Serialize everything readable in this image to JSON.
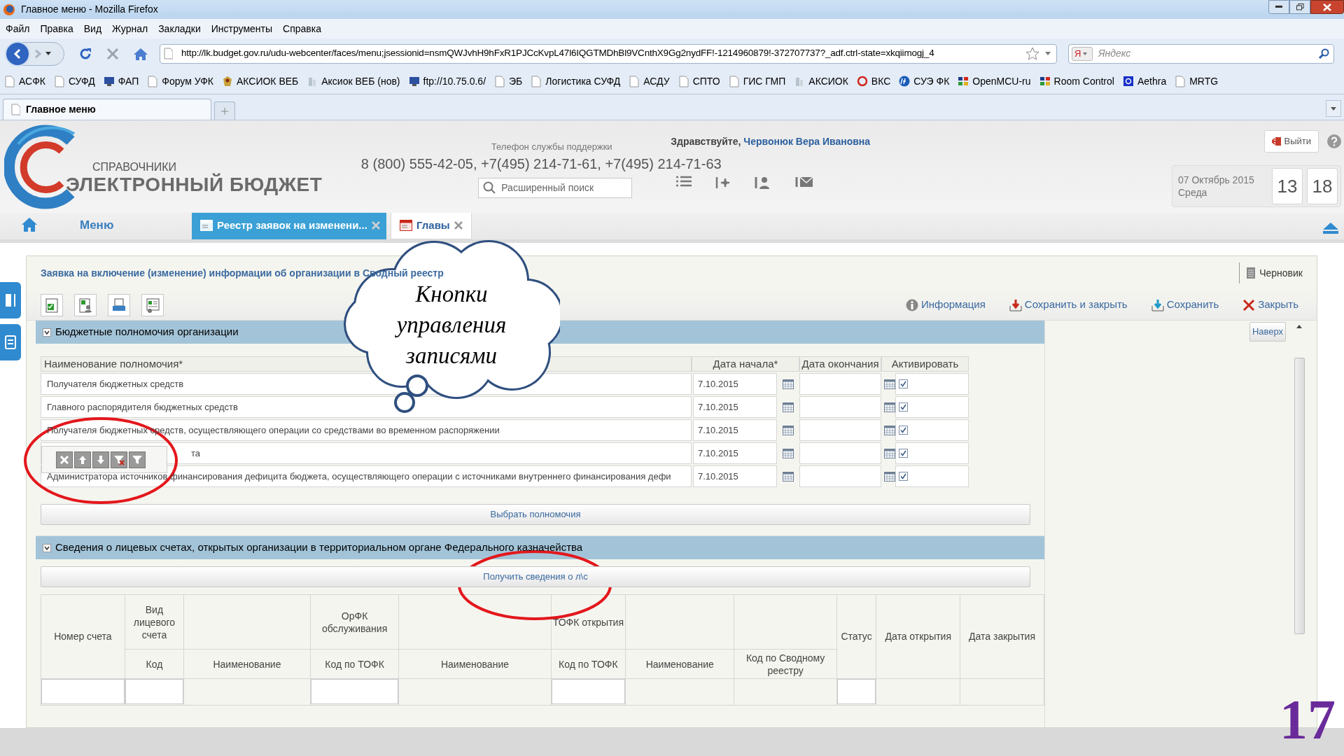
{
  "window": {
    "title": "Главное меню - Mozilla Firefox"
  },
  "menu_bar": [
    "Файл",
    "Правка",
    "Вид",
    "Журнал",
    "Закладки",
    "Инструменты",
    "Справка"
  ],
  "address_bar": {
    "url": "http://lk.budget.gov.ru/udu-webcenter/faces/menu;jsessionid=nsmQWJvhH9hFxR1PJCcKvpL47l6IQGTMDhBl9VCnthX9Gg2nydFF!-1214960879!-372707737?_adf.ctrl-state=xkqiimogj_4"
  },
  "search_box": {
    "engine": "Я",
    "placeholder": "Яндекс"
  },
  "bookmarks": [
    {
      "label": "АСФК",
      "kind": "page"
    },
    {
      "label": "СУФД",
      "kind": "page"
    },
    {
      "label": "ФАП",
      "kind": "monitor"
    },
    {
      "label": "Форум УФК",
      "kind": "page"
    },
    {
      "label": "АКСИОК ВЕБ",
      "kind": "emblem"
    },
    {
      "label": "Аксиок ВЕБ (нов)",
      "kind": "building"
    },
    {
      "label": "ftp://10.75.0.6/",
      "kind": "monitor"
    },
    {
      "label": "ЭБ",
      "kind": "page"
    },
    {
      "label": "Логистика СУФД",
      "kind": "page"
    },
    {
      "label": "АСДУ",
      "kind": "page"
    },
    {
      "label": "СПТО",
      "kind": "page"
    },
    {
      "label": "ГИС ГМП",
      "kind": "page"
    },
    {
      "label": "АКСИОК",
      "kind": "building"
    },
    {
      "label": "ВКС",
      "kind": "ring"
    },
    {
      "label": "СУЭ ФК",
      "kind": "hp"
    },
    {
      "label": "OpenMCU-ru",
      "kind": "grid"
    },
    {
      "label": "Room Control",
      "kind": "grid"
    },
    {
      "label": "Aethra",
      "kind": "blue"
    },
    {
      "label": "MRTG",
      "kind": "page"
    }
  ],
  "tabs": [
    {
      "label": "Главное меню",
      "selected": true
    }
  ],
  "header": {
    "logo_small": "СПРАВОЧНИКИ",
    "logo_large": "ЭЛЕКТРОННЫЙ БЮДЖЕТ",
    "support_label": "Телефон службы поддержки",
    "phones": "8 (800) 555-42-05, +7(495) 214-71-61, +7(495) 214-71-63",
    "search_placeholder": "Расширенный поиск",
    "greeting": "Здравствуйте,",
    "user": "Червонюк Вера Ивановна",
    "logout": "Выйти",
    "date": "07 Октябрь 2015",
    "weekday": "Среда",
    "hours": "13",
    "minutes": "18"
  },
  "app_tabs": [
    {
      "label": "Меню",
      "kind": "menu",
      "selected": false
    },
    {
      "label": "Реестр заявок на изменени...",
      "kind": "tab",
      "selected": true
    },
    {
      "label": "Главы",
      "kind": "tab",
      "selected": false
    }
  ],
  "form": {
    "title": "Заявка на включение (изменение) информации об организации в Сводный реестр",
    "status": "Черновик",
    "actions": [
      {
        "label": "Информация",
        "kind": "info"
      },
      {
        "label": "Сохранить и закрыть",
        "kind": "save_close"
      },
      {
        "label": "Сохранить",
        "kind": "save"
      },
      {
        "label": "Закрыть",
        "kind": "close"
      }
    ],
    "top_button": "Наверх"
  },
  "powers_section": {
    "title": "Бюджетные полномочия организации",
    "expanded": true,
    "columns": [
      "Наименование полномочия*",
      "Дата начала*",
      "Дата окончания",
      "Активировать"
    ],
    "rows": [
      {
        "name": "Получателя бюджетных средств",
        "start": "7.10.2015",
        "active": true
      },
      {
        "name": "Главного распорядителя бюджетных средств",
        "start": "7.10.2015",
        "active": true
      },
      {
        "name": "Получателя бюджетных средств, осуществляющего операции со средствами во временном распоряжении",
        "start": "7.10.2015",
        "active": true
      },
      {
        "name": "та",
        "start": "7.10.2015",
        "active": true
      },
      {
        "name": "Администратора источников финансирования дефицита бюджета, осуществляющего операции с источниками внутреннего финансирования дефи",
        "start": "7.10.2015",
        "active": true
      }
    ],
    "button": "Выбрать полномочия"
  },
  "accounts_section": {
    "title": "Сведения о лицевых счетах, открытых организации в территориальном органе Федерального казначейства",
    "expanded": true,
    "button": "Получить сведения о л\\с",
    "columns": [
      {
        "label": "Номер счета",
        "kind": "single",
        "input": true
      },
      {
        "group": "Вид лицевого счета",
        "label": "Код",
        "kind": "sub",
        "input": true
      },
      {
        "label": "Наименование",
        "kind": "sub",
        "input": false
      },
      {
        "group": "ОрФК обслуживания",
        "label": "Код по ТОФК",
        "kind": "sub",
        "input": true
      },
      {
        "label": "Наименование",
        "kind": "sub",
        "input": false
      },
      {
        "group": "ТОФК открытия",
        "label": "Код по ТОФК",
        "kind": "sub",
        "input": true
      },
      {
        "label": "Наименование",
        "kind": "sub",
        "input": false
      },
      {
        "label": "Код по Сводному реестру",
        "kind": "sub",
        "input": false
      },
      {
        "label": "Статус",
        "kind": "single",
        "input": true
      },
      {
        "label": "Дата открытия",
        "kind": "single",
        "input": false
      },
      {
        "label": "Дата закрытия",
        "kind": "single",
        "input": false
      }
    ]
  },
  "annotations": {
    "callout_lines": [
      "Кнопки",
      "управления",
      "записями"
    ],
    "page_number": "17"
  }
}
